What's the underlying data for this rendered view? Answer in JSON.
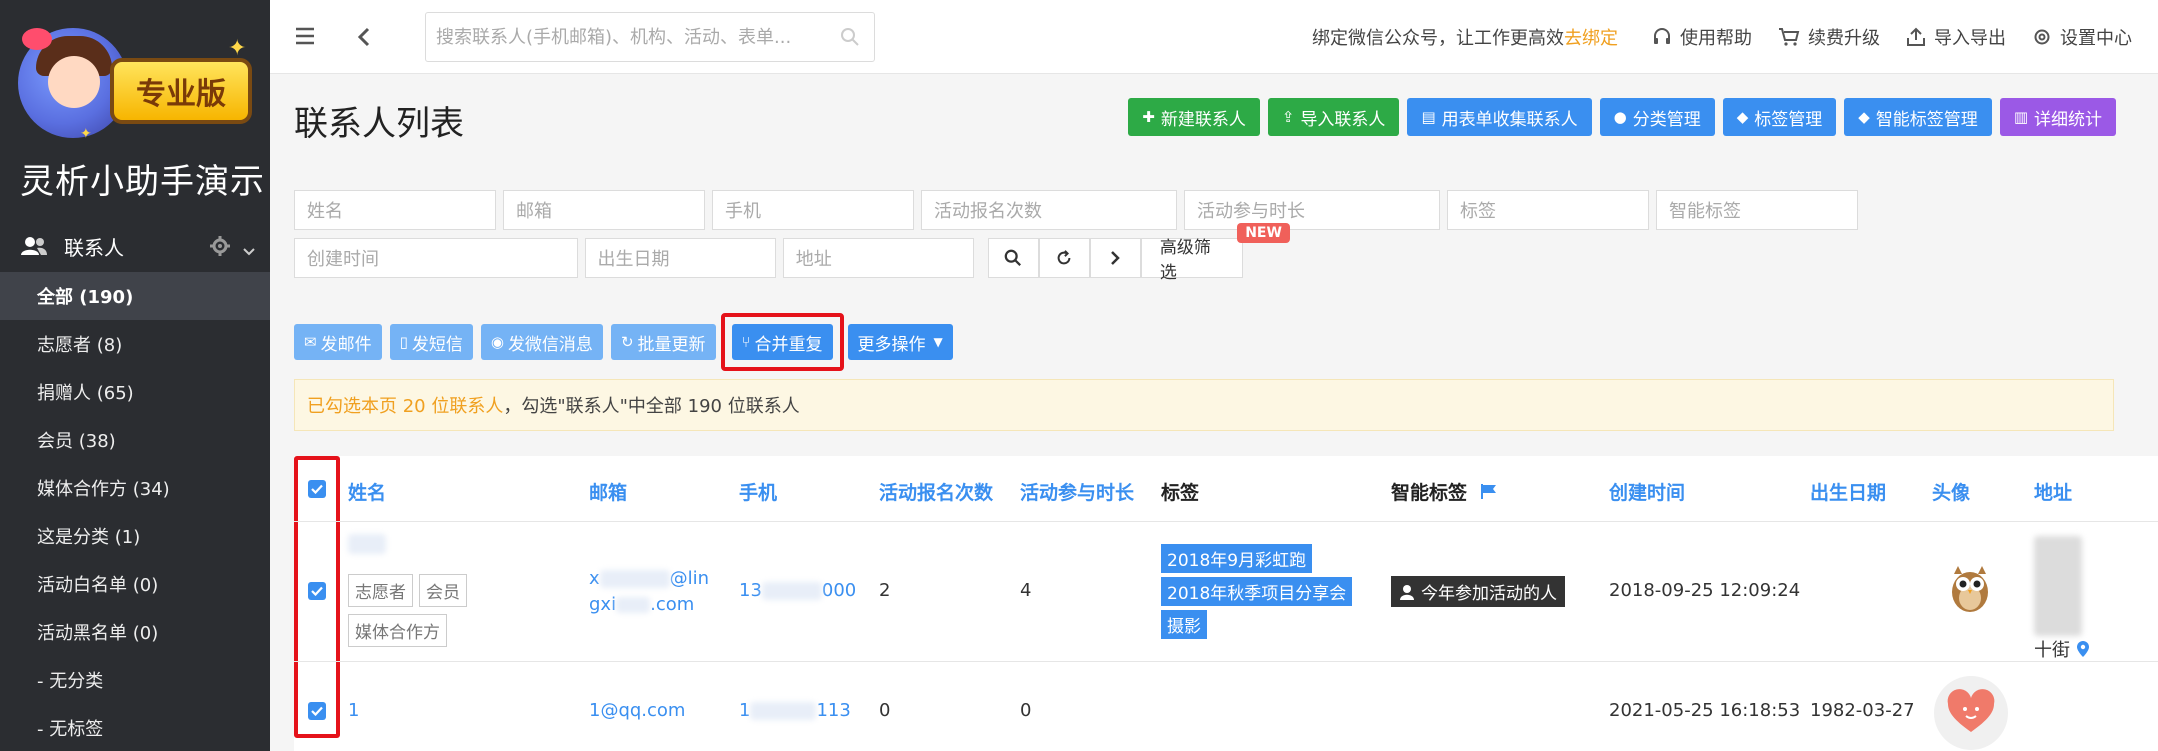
{
  "sidebar": {
    "badge_text": "专业版",
    "app_title": "灵析小助手演示",
    "section_label": "联系人",
    "items": [
      {
        "label": "全部 (190)",
        "active": true
      },
      {
        "label": "志愿者 (8)"
      },
      {
        "label": "捐赠人 (65)"
      },
      {
        "label": "会员 (38)"
      },
      {
        "label": "媒体合作方 (34)"
      },
      {
        "label": "这是分类 (1)"
      },
      {
        "label": "活动白名单 (0)"
      },
      {
        "label": "活动黑名单 (0)"
      },
      {
        "label": "- 无分类"
      },
      {
        "label": "- 无标签"
      }
    ]
  },
  "topbar": {
    "search_placeholder": "搜索联系人(手机邮箱)、机构、活动、表单...",
    "wechat_text": "绑定微信公众号，让工作更高效",
    "wechat_link": "去绑定",
    "help": "使用帮助",
    "upgrade": "续费升级",
    "import_export": "导入导出",
    "settings": "设置中心"
  },
  "page": {
    "title": "联系人列表",
    "actions": [
      "新建联系人",
      "导入联系人",
      "用表单收集联系人",
      "分类管理",
      "标签管理",
      "智能标签管理",
      "详细统计"
    ]
  },
  "filters": {
    "row1": [
      "姓名",
      "邮箱",
      "手机",
      "活动报名次数",
      "活动参与时长",
      "标签",
      "智能标签"
    ],
    "row2": [
      "创建时间",
      "出生日期",
      "地址"
    ],
    "advanced": "高级筛选",
    "new_badge": "NEW"
  },
  "ops": {
    "email": "发邮件",
    "sms": "发短信",
    "wechat": "发微信消息",
    "batch_update": "批量更新",
    "merge": "合并重复",
    "more": "更多操作"
  },
  "notice": {
    "selected": "已勾选本页 20 位联系人",
    "rest": "，勾选\"联系人\"中全部 190 位联系人"
  },
  "table": {
    "headers": {
      "name": "姓名",
      "email": "邮箱",
      "phone": "手机",
      "signup_count": "活动报名次数",
      "duration": "活动参与时长",
      "tags": "标签",
      "smart_tags": "智能标签",
      "created": "创建时间",
      "birthday": "出生日期",
      "avatar": "头像",
      "address": "地址"
    },
    "rows": [
      {
        "categories": [
          "志愿者",
          "会员",
          "媒体合作方"
        ],
        "email_start": "x",
        "email_mid": "@lin",
        "email_end": "gxi",
        "email_tail": ".com",
        "phone_start": "13",
        "phone_end": "000",
        "signup_count": "2",
        "duration": "4",
        "tags": [
          "2018年9月彩虹跑",
          "2018年秋季项目分享会",
          "摄影"
        ],
        "smart_tag": "今年参加活动的人",
        "created": "2018-09-25 12:09:24",
        "birthday": "",
        "address_tail": "十街"
      },
      {
        "name": "1",
        "email": "1@qq.com",
        "phone_start": "1",
        "phone_end": "113",
        "signup_count": "0",
        "duration": "0",
        "created": "2021-05-25 16:18:53",
        "birthday": "1982-03-27"
      }
    ]
  }
}
